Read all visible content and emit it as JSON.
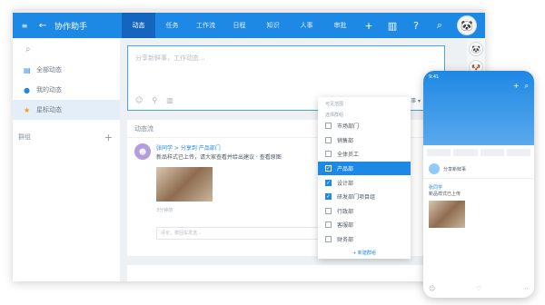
{
  "topbar": {
    "app_title": "协作助手",
    "tabs": [
      "动态",
      "任务",
      "工作流",
      "日程",
      "知识",
      "人事",
      "审批"
    ],
    "active_tab": 0,
    "icons": [
      "plus-icon",
      "book-icon",
      "help-icon",
      "search-icon"
    ]
  },
  "sidebar": {
    "search_icon": "search-icon",
    "items": [
      {
        "icon": "feed-icon",
        "label": "全部动态"
      },
      {
        "icon": "user-icon",
        "label": "我的动态"
      },
      {
        "icon": "star-icon",
        "label": "星标动态"
      }
    ],
    "active_item": 2,
    "group_label": "群组"
  },
  "composer": {
    "placeholder": "分享新鲜事，工作动态...",
    "visibility": "所有同事 ▾"
  },
  "feed": {
    "title": "动态流",
    "post": {
      "author": "张同学 > 分享到 产品部门",
      "text": "新品样式已上传，请大家查看并给出建议 · 查看原图",
      "time": "3分钟前",
      "comment_placeholder": "评论，按回车发送..."
    }
  },
  "dropdown": {
    "section_label": "可见范围",
    "sub_label": "选择群组",
    "items": [
      {
        "label": "市场部门",
        "checked": false
      },
      {
        "label": "销售部",
        "checked": false
      },
      {
        "label": "全体员工",
        "checked": false
      },
      {
        "label": "产品部",
        "checked": true,
        "highlight": true
      },
      {
        "label": "设计部",
        "checked": true
      },
      {
        "label": "研发部门项目组",
        "checked": true
      },
      {
        "label": "行政部",
        "checked": false
      },
      {
        "label": "客服部",
        "checked": false
      },
      {
        "label": "财务部",
        "checked": false
      }
    ],
    "footer": "+ 新建群组"
  },
  "phone": {
    "status": "9:41",
    "row_label": "分享新鲜事",
    "post_author": "张同学",
    "post_text": "新品样式已上传"
  }
}
